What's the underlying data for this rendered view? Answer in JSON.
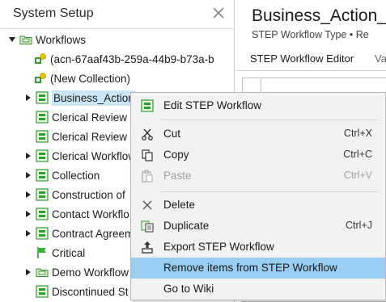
{
  "left_panel": {
    "title": "System Setup",
    "tree": [
      {
        "label": "Workflows",
        "icon": "folder-icon",
        "expanded": true
      },
      {
        "label": "(acn-67aaf43b-259a-44b9-b73a-b",
        "icon": "collection-icon"
      },
      {
        "label": "(New Collection)",
        "icon": "collection-icon"
      },
      {
        "label": "Business_Action",
        "icon": "workflow-icon",
        "selected": true
      },
      {
        "label": "Clerical Review C",
        "icon": "workflow-icon"
      },
      {
        "label": "Clerical Review V",
        "icon": "workflow-icon"
      },
      {
        "label": "Clerical Workflow",
        "icon": "workflow-icon"
      },
      {
        "label": "Collection",
        "icon": "workflow-icon"
      },
      {
        "label": "Construction of",
        "icon": "workflow-icon"
      },
      {
        "label": "Contact Workflo",
        "icon": "workflow-icon"
      },
      {
        "label": "Contract Agreem",
        "icon": "workflow-icon"
      },
      {
        "label": "Critical",
        "icon": "flag-icon"
      },
      {
        "label": "Demo Workflow",
        "icon": "folder-icon"
      },
      {
        "label": "Discontinued St",
        "icon": "workflow-icon"
      }
    ]
  },
  "right_panel": {
    "title": "Business_Action_W",
    "subtitle": "STEP Workflow Type • Re",
    "tabs": [
      {
        "label": "STEP Workflow Editor"
      },
      {
        "label": "Va"
      }
    ]
  },
  "context_menu": {
    "items": [
      {
        "label": "Edit STEP Workflow",
        "shortcut": "",
        "icon": "workflow-edit-icon"
      },
      {
        "label": "Cut",
        "shortcut": "Ctrl+X",
        "icon": "cut-icon"
      },
      {
        "label": "Copy",
        "shortcut": "Ctrl+C",
        "icon": "copy-icon"
      },
      {
        "label": "Paste",
        "shortcut": "Ctrl+V",
        "icon": "paste-icon",
        "disabled": true
      },
      {
        "label": "Delete",
        "shortcut": "",
        "icon": "delete-icon"
      },
      {
        "label": "Duplicate",
        "shortcut": "Ctrl+J",
        "icon": "duplicate-icon"
      },
      {
        "label": "Export STEP Workflow",
        "shortcut": "",
        "icon": "export-icon"
      },
      {
        "label": "Remove items from STEP Workflow",
        "shortcut": "",
        "icon": "",
        "hovered": true
      },
      {
        "label": "Go to Wiki",
        "shortcut": "",
        "icon": ""
      }
    ]
  },
  "colors": {
    "selection": "#cde6f7",
    "menu_hover": "#99cdf2",
    "menu_bg": "#f2f2f2",
    "workflow_icon_green": "#2e9e2e"
  }
}
